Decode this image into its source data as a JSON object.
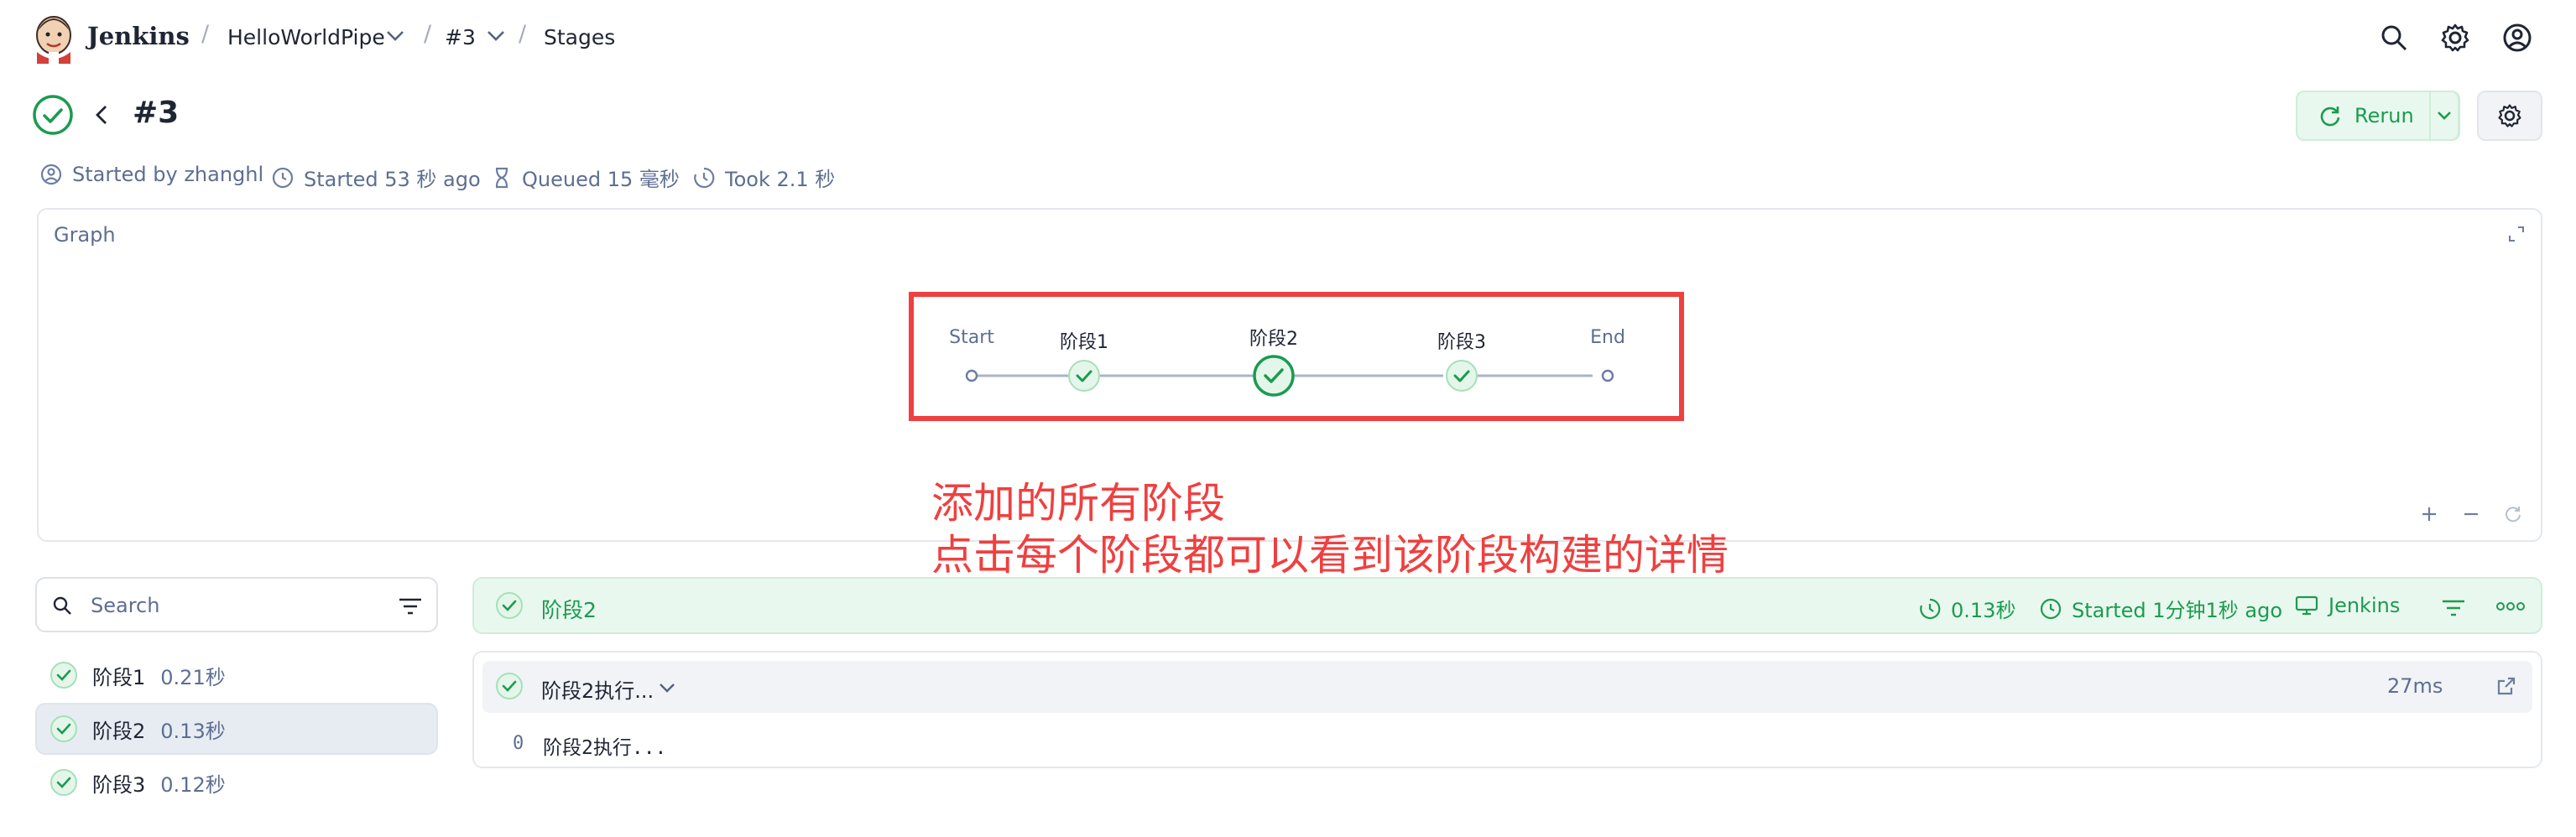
{
  "header": {
    "brand": "Jenkins",
    "breadcrumbs": [
      "HelloWorldPipe",
      "#3",
      "Stages"
    ]
  },
  "build": {
    "title": "#3",
    "rerun_label": "Rerun",
    "meta": {
      "started_by": "Started by zhanghl",
      "started": "Started 53 秒 ago",
      "queued": "Queued 15 毫秒",
      "took": "Took 2.1 秒"
    }
  },
  "graph": {
    "title": "Graph",
    "nodes": [
      {
        "label": "Start"
      },
      {
        "label": "阶段1"
      },
      {
        "label": "阶段2"
      },
      {
        "label": "阶段3"
      },
      {
        "label": "End"
      }
    ]
  },
  "annotation": {
    "line1": "添加的所有阶段",
    "line2": "点击每个阶段都可以看到该阶段构建的详情"
  },
  "sidebar": {
    "search_placeholder": "Search",
    "stages": [
      {
        "name": "阶段1",
        "duration": "0.21秒"
      },
      {
        "name": "阶段2",
        "duration": "0.13秒"
      },
      {
        "name": "阶段3",
        "duration": "0.12秒"
      }
    ]
  },
  "detail": {
    "stage_name": "阶段2",
    "duration": "0.13秒",
    "started": "Started 1分钟1秒 ago",
    "agent": "Jenkins",
    "step": {
      "title": "阶段2执行...",
      "duration": "27ms",
      "log_line_no": "0",
      "log_text": "阶段2执行..."
    }
  },
  "colors": {
    "success": "#1b9b50",
    "annotation": "#ef4040",
    "muted": "#5d6e92"
  }
}
